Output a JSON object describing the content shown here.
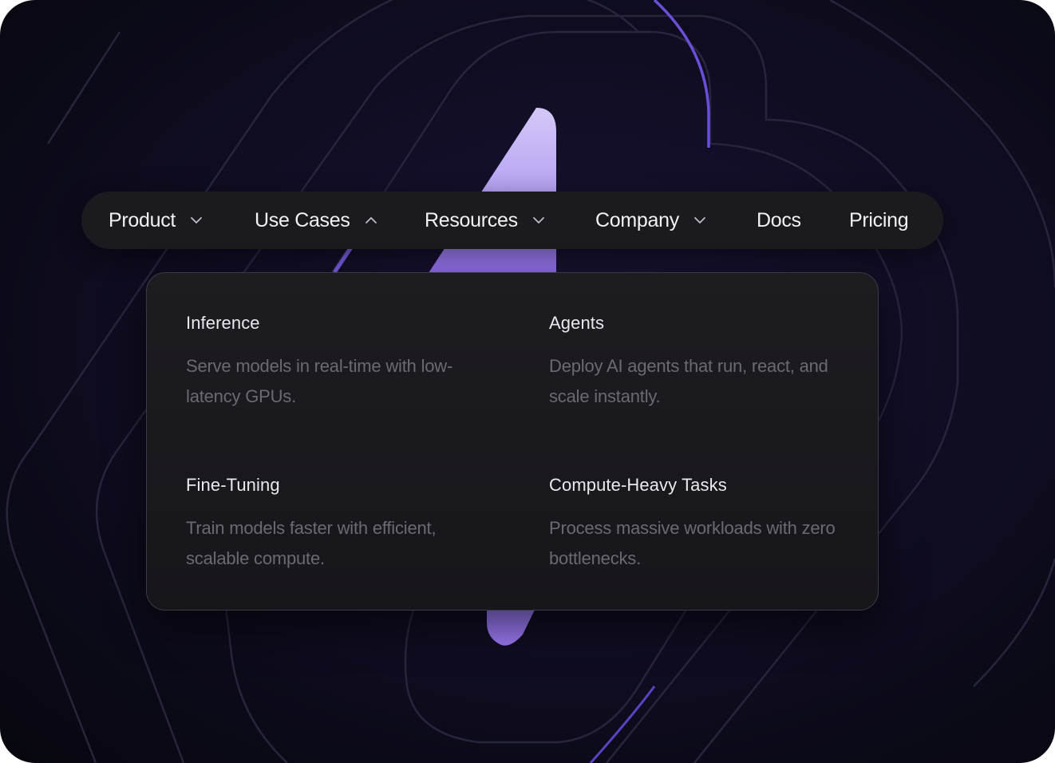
{
  "theme": {
    "background": "#0f0c1f",
    "accent": "#9b7cf0",
    "accent_light": "#c9b9f8",
    "nav_bg": "#1b1a1f",
    "panel_bg": "#1a191e",
    "text_primary": "#f2f2f4",
    "text_muted": "#6a6a72"
  },
  "nav": {
    "items": [
      {
        "label": "Product",
        "has_dropdown": true,
        "expanded": false,
        "icon": "chevron-down-icon"
      },
      {
        "label": "Use Cases",
        "has_dropdown": true,
        "expanded": true,
        "icon": "chevron-up-icon"
      },
      {
        "label": "Resources",
        "has_dropdown": true,
        "expanded": false,
        "icon": "chevron-down-icon"
      },
      {
        "label": "Company",
        "has_dropdown": true,
        "expanded": false,
        "icon": "chevron-down-icon"
      },
      {
        "label": "Docs",
        "has_dropdown": false
      },
      {
        "label": "Pricing",
        "has_dropdown": false
      }
    ]
  },
  "use_cases_menu": {
    "items": [
      {
        "title": "Inference",
        "description": "Serve models in real-time with low-latency GPUs."
      },
      {
        "title": "Agents",
        "description": "Deploy AI agents that run, react, and scale instantly."
      },
      {
        "title": "Fine-Tuning",
        "description": "Train models faster with efficient, scalable compute."
      },
      {
        "title": "Compute-Heavy Tasks",
        "description": "Process massive workloads with zero bottlenecks."
      }
    ]
  }
}
